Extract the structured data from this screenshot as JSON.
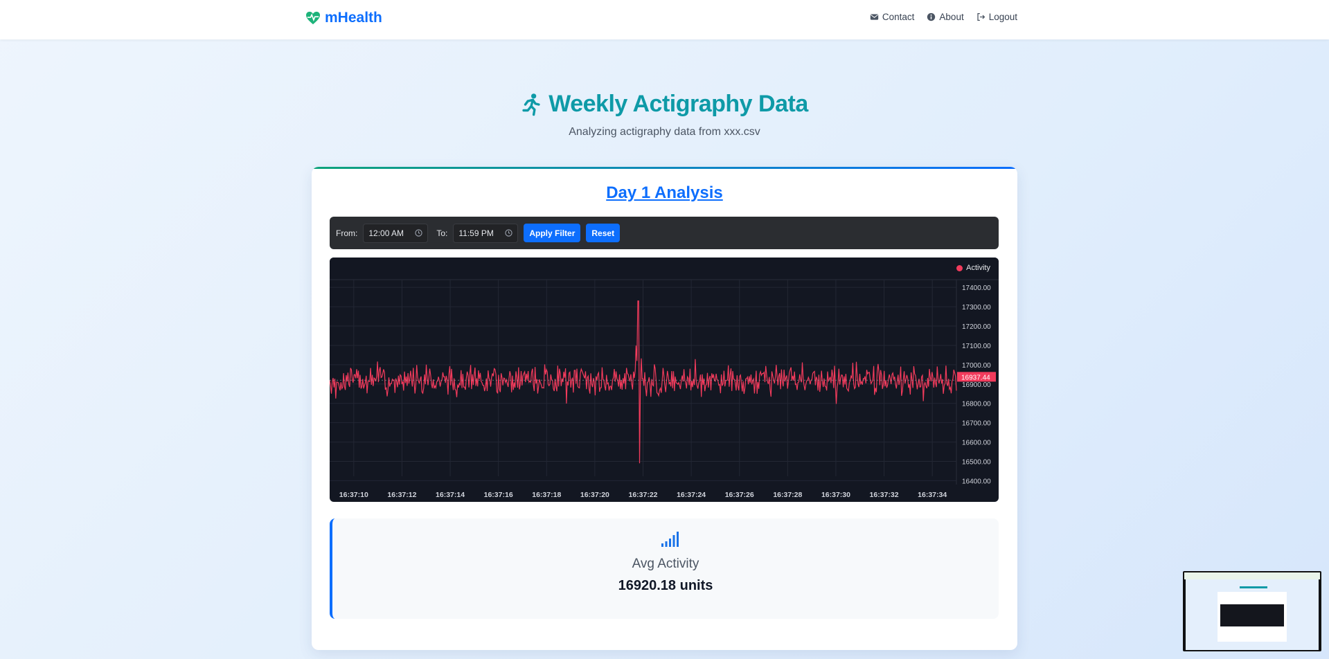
{
  "nav": {
    "brand": "mHealth",
    "links": [
      {
        "label": "Contact",
        "icon": "envelope-icon"
      },
      {
        "label": "About",
        "icon": "info-circle-icon"
      },
      {
        "label": "Logout",
        "icon": "sign-out-icon"
      }
    ]
  },
  "header": {
    "title": "Weekly Actigraphy Data",
    "subtitle": "Analyzing actigraphy data from xxx.csv"
  },
  "card": {
    "day_title": "Day 1 Analysis",
    "filter": {
      "from_label": "From:",
      "from_value": "12:00 AM",
      "to_label": "To:",
      "to_value": "11:59 PM",
      "apply_label": "Apply Filter",
      "reset_label": "Reset"
    },
    "stat": {
      "label": "Avg Activity",
      "value": "16920.18 units"
    }
  },
  "colors": {
    "brand": "#0d6efd",
    "title": "#0e9aa7",
    "series": "#f23b5c",
    "chart_bg": "#131722"
  },
  "chart_data": {
    "type": "line",
    "legend": [
      "Activity"
    ],
    "series": [
      {
        "name": "Activity",
        "color": "#f23b5c"
      }
    ],
    "last_value_label": "16937.44",
    "x_ticks": [
      "16:37:10",
      "16:37:12",
      "16:37:14",
      "16:37:16",
      "16:37:18",
      "16:37:20",
      "16:37:22",
      "16:37:24",
      "16:37:26",
      "16:37:28",
      "16:37:30",
      "16:37:32",
      "16:37:34"
    ],
    "y_ticks": [
      "17400.00",
      "17300.00",
      "17200.00",
      "17100.00",
      "17000.00",
      "16900.00",
      "16800.00",
      "16700.00",
      "16600.00",
      "16500.00",
      "16400.00"
    ],
    "ylim": [
      16380,
      17440
    ],
    "x_start": "16:37:09",
    "x_end": "16:37:35",
    "mean": 16920,
    "noise_amplitude": 90,
    "spike": {
      "time": "16:37:21.8",
      "max": 17330,
      "min": 16490
    },
    "grid": true,
    "legend_position": "top-right"
  }
}
